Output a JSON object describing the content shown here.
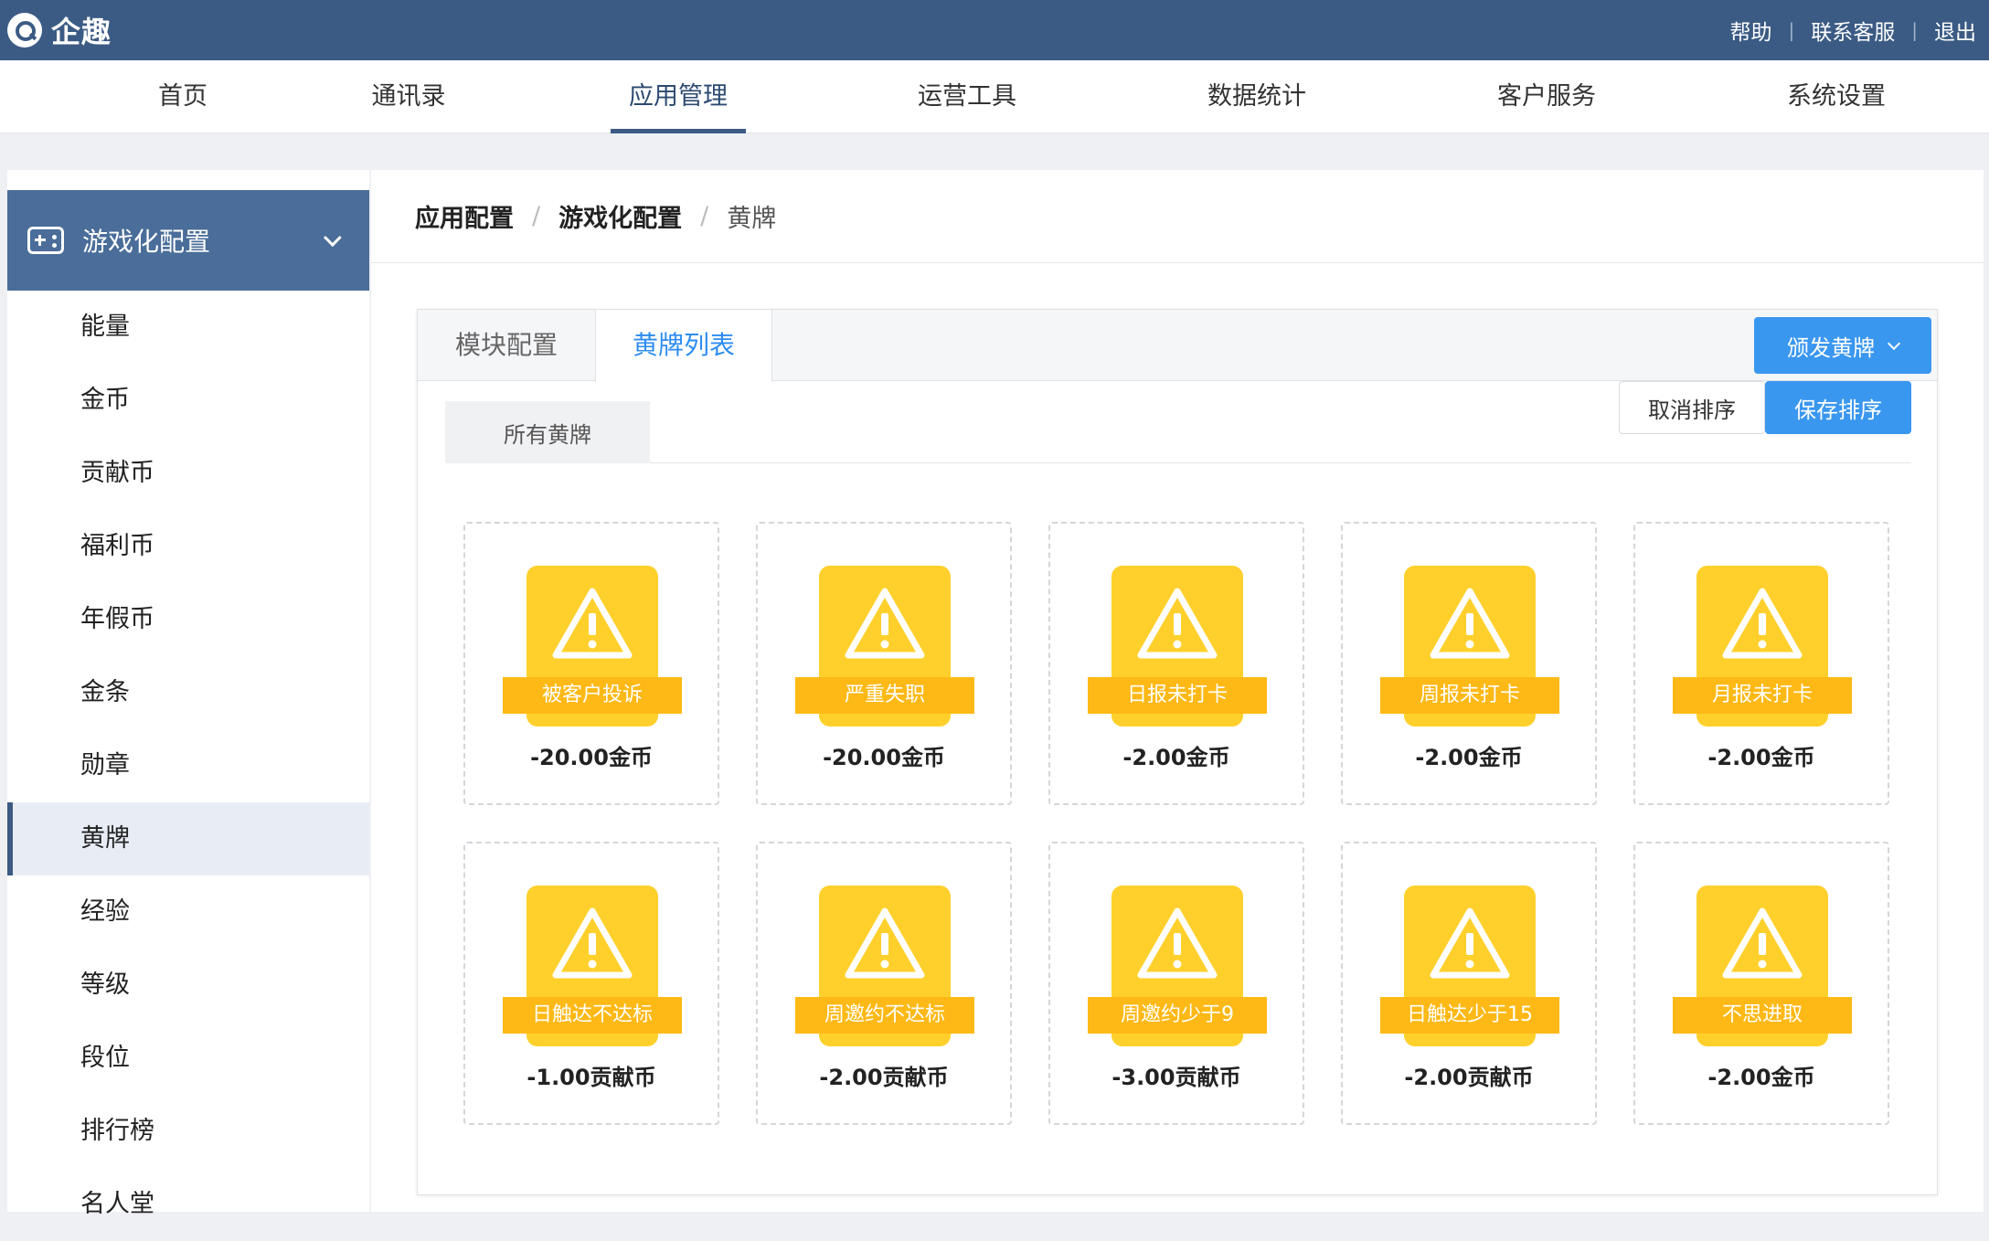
{
  "app": {
    "name": "企趣"
  },
  "top_links": [
    "帮助",
    "联系客服",
    "退出"
  ],
  "nav": {
    "items": [
      "首页",
      "通讯录",
      "应用管理",
      "运营工具",
      "数据统计",
      "客户服务",
      "系统设置"
    ],
    "active": "应用管理"
  },
  "sidebar": {
    "section_title": "游戏化配置",
    "items": [
      "能量",
      "金币",
      "贡献币",
      "福利币",
      "年假币",
      "金条",
      "勋章",
      "黄牌",
      "经验",
      "等级",
      "段位",
      "排行榜",
      "名人堂"
    ],
    "active": "黄牌"
  },
  "breadcrumb": [
    "应用配置",
    "游戏化配置",
    "黄牌"
  ],
  "tabs": [
    "模块配置",
    "黄牌列表"
  ],
  "active_tab": "黄牌列表",
  "issue_button": "颁发黄牌",
  "filter": {
    "label": "所有黄牌"
  },
  "cancel_sort": "取消排序",
  "save_sort": "保存排序",
  "badges": [
    {
      "name": "被客户投诉",
      "value": "-20.00金币"
    },
    {
      "name": "严重失职",
      "value": "-20.00金币"
    },
    {
      "name": "日报未打卡",
      "value": "-2.00金币"
    },
    {
      "name": "周报未打卡",
      "value": "-2.00金币"
    },
    {
      "name": "月报未打卡",
      "value": "-2.00金币"
    },
    {
      "name": "日触达不达标",
      "value": "-1.00贡献币"
    },
    {
      "name": "周邀约不达标",
      "value": "-2.00贡献币"
    },
    {
      "name": "周邀约少于9",
      "value": "-3.00贡献币"
    },
    {
      "name": "日触达少于15",
      "value": "-2.00贡献币"
    },
    {
      "name": "不思进取",
      "value": "-2.00金币"
    }
  ],
  "colors": {
    "header": "#3b5b84",
    "sidebar_head": "#4a6d99",
    "primary_button": "#3a97f0",
    "badge_fill": "#ffd02b",
    "badge_ribbon": "#ffb916"
  },
  "icons": {
    "badge": "warning-icon",
    "logo": "logo-icon",
    "sidebar_head": "gamepad-icon"
  }
}
